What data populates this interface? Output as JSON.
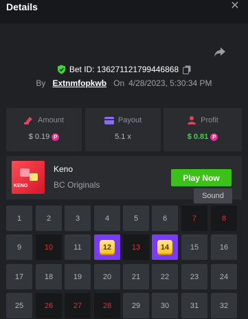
{
  "header": {
    "title": "Details",
    "close_icon": "close-icon"
  },
  "bet": {
    "id_label": "Bet ID: 136271121799446868",
    "by_label": "By",
    "username": "Extnmfopkwb",
    "on_label": "On",
    "datetime": "4/28/2023, 5:30:34 PM",
    "verified_color": "#44d23f"
  },
  "stats": {
    "amount": {
      "label": "Amount",
      "value": "$ 0.19"
    },
    "payout": {
      "label": "Payout",
      "value": "5.1 x"
    },
    "profit": {
      "label": "Profit",
      "value": "$ 0.81"
    },
    "coin_glyph": "P",
    "coin_color": "#e72d8e"
  },
  "game": {
    "name": "Keno",
    "provider": "BC Originals",
    "thumb_label": "KENO",
    "play_label": "Play Now",
    "play_color": "#3bc117"
  },
  "tooltip": {
    "text": "Sound"
  },
  "grid": {
    "rows": [
      [
        {
          "n": "1",
          "s": "normal"
        },
        {
          "n": "2",
          "s": "normal"
        },
        {
          "n": "3",
          "s": "normal"
        },
        {
          "n": "4",
          "s": "normal"
        },
        {
          "n": "5",
          "s": "normal"
        },
        {
          "n": "6",
          "s": "normal"
        },
        {
          "n": "7",
          "s": "hit"
        },
        {
          "n": "8",
          "s": "hit"
        }
      ],
      [
        {
          "n": "9",
          "s": "normal"
        },
        {
          "n": "10",
          "s": "hit"
        },
        {
          "n": "11",
          "s": "normal"
        },
        {
          "n": "12",
          "s": "match"
        },
        {
          "n": "13",
          "s": "hit"
        },
        {
          "n": "14",
          "s": "match"
        },
        {
          "n": "15",
          "s": "normal"
        },
        {
          "n": "16",
          "s": "normal"
        }
      ],
      [
        {
          "n": "17",
          "s": "normal"
        },
        {
          "n": "18",
          "s": "normal"
        },
        {
          "n": "19",
          "s": "normal"
        },
        {
          "n": "20",
          "s": "normal"
        },
        {
          "n": "21",
          "s": "normal"
        },
        {
          "n": "22",
          "s": "normal"
        },
        {
          "n": "23",
          "s": "normal"
        },
        {
          "n": "24",
          "s": "normal"
        }
      ],
      [
        {
          "n": "25",
          "s": "normal"
        },
        {
          "n": "26",
          "s": "hit"
        },
        {
          "n": "27",
          "s": "hit"
        },
        {
          "n": "28",
          "s": "hit"
        },
        {
          "n": "29",
          "s": "normal"
        },
        {
          "n": "30",
          "s": "normal"
        },
        {
          "n": "31",
          "s": "normal"
        },
        {
          "n": "32",
          "s": "normal"
        }
      ]
    ],
    "colors": {
      "normal": "#33363a",
      "hit": "#17181a",
      "match": "#7a3cf3",
      "hit_text": "#e0302f"
    }
  }
}
